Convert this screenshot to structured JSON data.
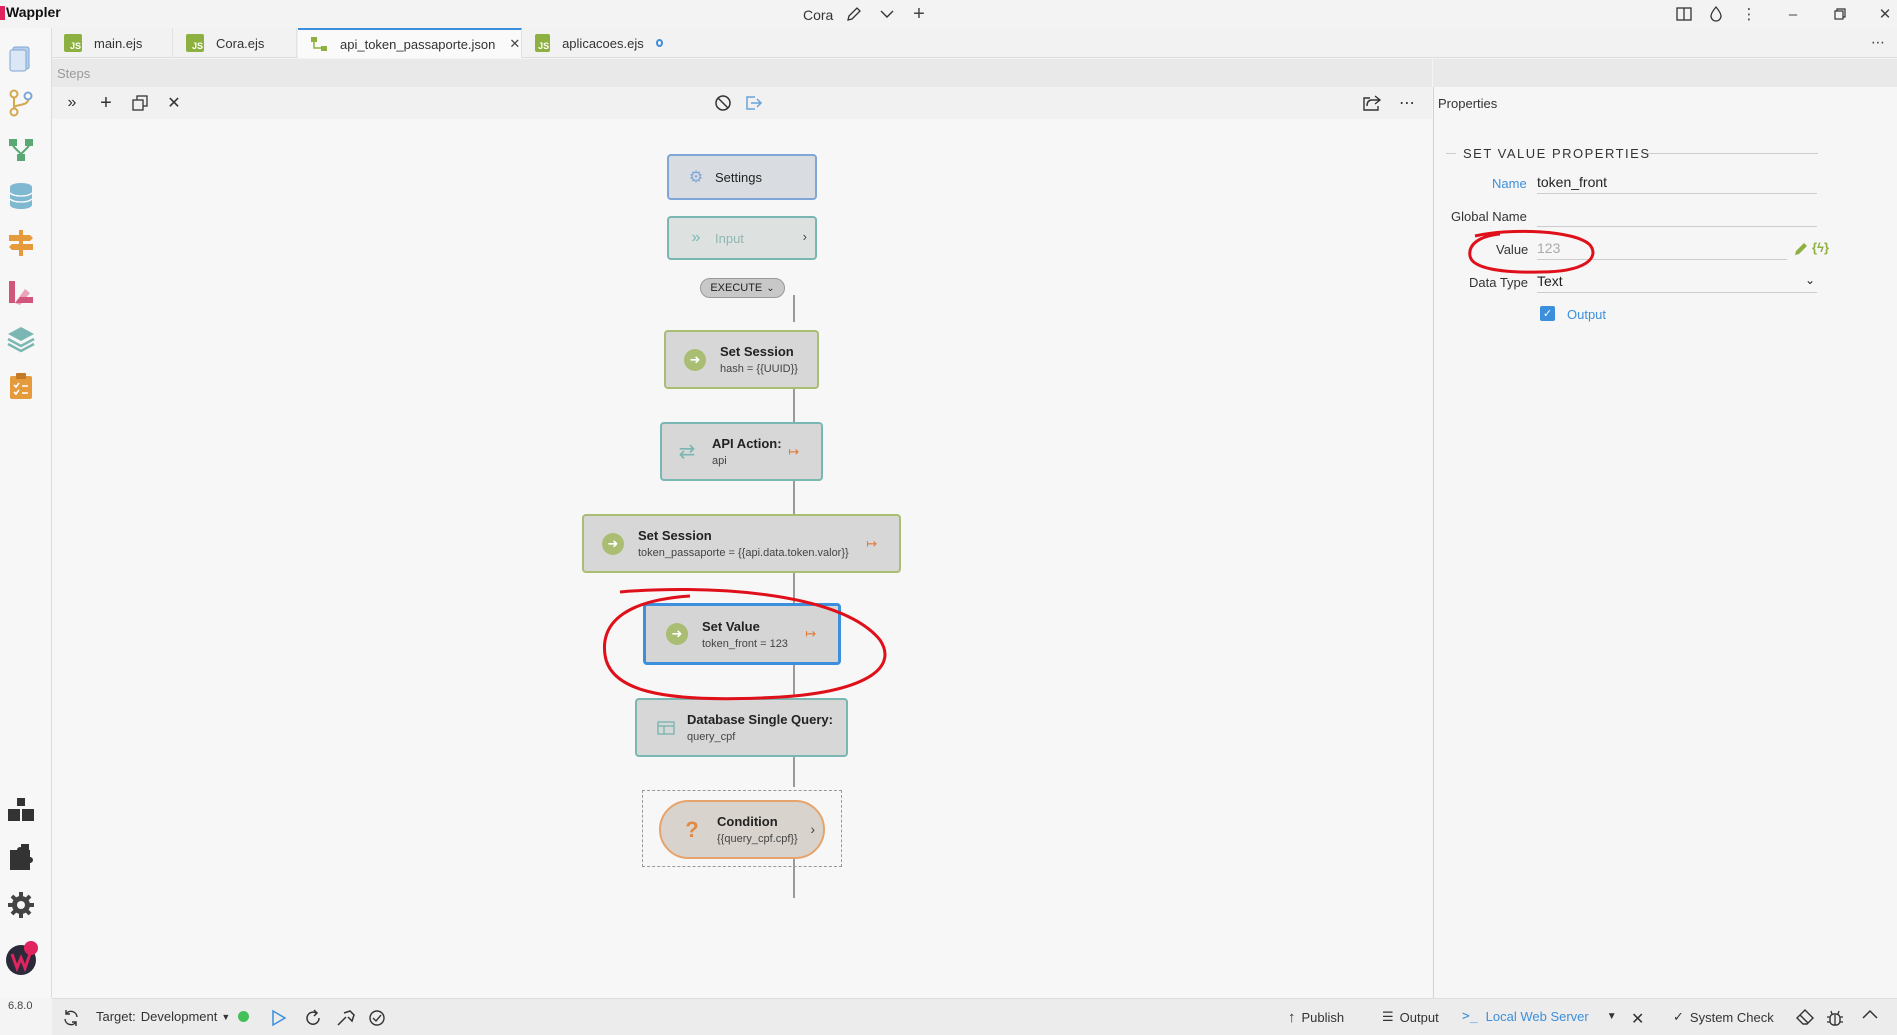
{
  "app": {
    "title": "Wappler",
    "project": "Cora",
    "version": "6.8.0"
  },
  "tabs": [
    {
      "label": "main.ejs",
      "badge": "JS"
    },
    {
      "label": "Cora.ejs",
      "badge": "JS"
    },
    {
      "label": "api_token_passaporte.json",
      "badge": "",
      "active": true
    },
    {
      "label": "aplicacoes.ejs",
      "badge": "JS"
    }
  ],
  "steps": {
    "header": "Steps",
    "execute_label": "EXECUTE",
    "nodes": [
      {
        "title": "Settings",
        "subtitle": ""
      },
      {
        "title": "Input",
        "subtitle": ""
      },
      {
        "title": "Set Session",
        "subtitle": "hash = {{UUID}}"
      },
      {
        "title": "API Action:",
        "subtitle": "api"
      },
      {
        "title": "Set Session",
        "subtitle": "token_passaporte = {{api.data.token.valor}}"
      },
      {
        "title": "Set Value",
        "subtitle": "token_front = 123"
      },
      {
        "title": "Database Single Query:",
        "subtitle": "query_cpf"
      },
      {
        "title": "Condition",
        "subtitle": "{{query_cpf.cpf}}"
      }
    ]
  },
  "properties": {
    "header": "Properties",
    "section_title": "SET VALUE PROPERTIES",
    "name_label": "Name",
    "name_value": "token_front",
    "global_name_label": "Global Name",
    "value_label": "Value",
    "value_value": "123",
    "data_type_label": "Data Type",
    "data_type_value": "Text",
    "output_label": "Output",
    "output_checked": true
  },
  "statusbar": {
    "target_label": "Target:",
    "target_value": "Development",
    "publish": "Publish",
    "output": "Output",
    "server": "Local Web Server",
    "system_check": "System Check"
  },
  "colors": {
    "accent": "#3c8fdc",
    "annotation": "#e0101a",
    "step_green": "#a9bd73",
    "exit_orange": "#e07b39"
  }
}
